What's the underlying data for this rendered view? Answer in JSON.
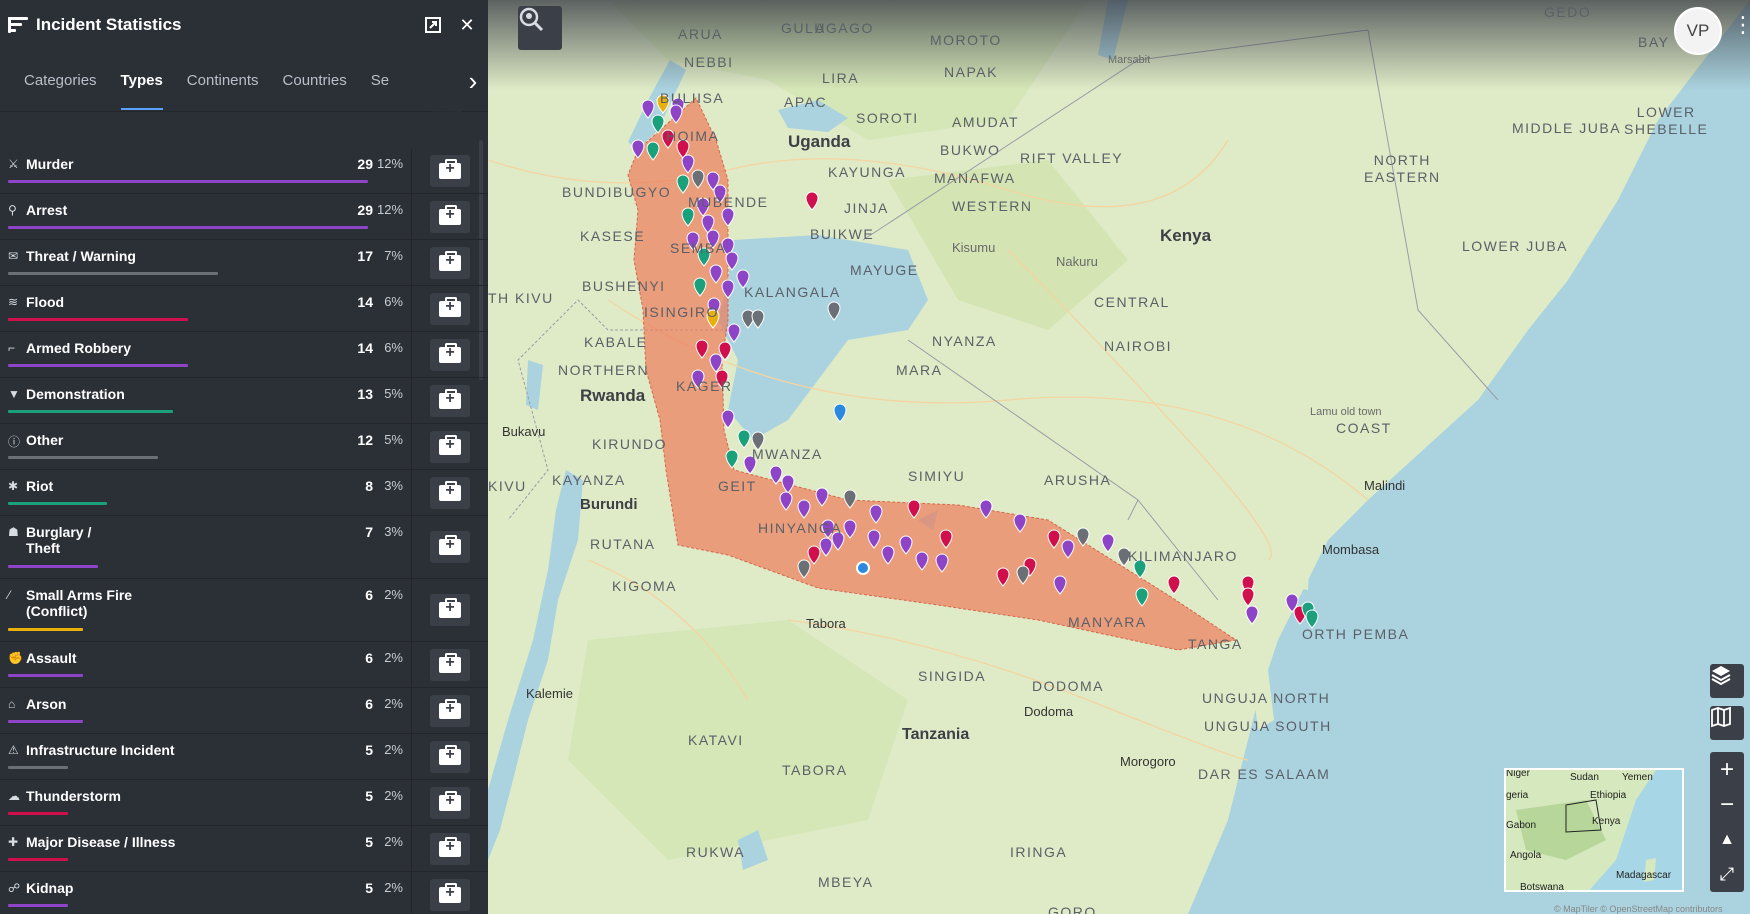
{
  "panel": {
    "title": "Incident Statistics",
    "tabs": [
      "Categories",
      "Types",
      "Continents",
      "Countries",
      "Se"
    ],
    "active_tab": "Types",
    "rows": [
      {
        "icon": "murder-icon",
        "glyph": "⚔",
        "name": "Murder",
        "count": "29",
        "pct": "12%",
        "share": 0.12,
        "color": "#8e44c7"
      },
      {
        "icon": "arrest-icon",
        "glyph": "⚲",
        "name": "Arrest",
        "count": "29",
        "pct": "12%",
        "share": 0.12,
        "color": "#8e44c7"
      },
      {
        "icon": "threat-icon",
        "glyph": "✉",
        "name": "Threat / Warning",
        "count": "17",
        "pct": "7%",
        "share": 0.07,
        "color": "#6b6f76"
      },
      {
        "icon": "flood-icon",
        "glyph": "≋",
        "name": "Flood",
        "count": "14",
        "pct": "6%",
        "share": 0.06,
        "color": "#d0104c"
      },
      {
        "icon": "armed-robbery-icon",
        "glyph": "⌐",
        "name": "Armed Robbery",
        "count": "14",
        "pct": "6%",
        "share": 0.06,
        "color": "#8e44c7"
      },
      {
        "icon": "demonstration-icon",
        "glyph": "▼",
        "name": "Demonstration",
        "count": "13",
        "pct": "5%",
        "share": 0.055,
        "color": "#1aa07a"
      },
      {
        "icon": "other-icon",
        "glyph": "ⓘ",
        "name": "Other",
        "count": "12",
        "pct": "5%",
        "share": 0.05,
        "color": "#6b6f76"
      },
      {
        "icon": "riot-icon",
        "glyph": "✱",
        "name": "Riot",
        "count": "8",
        "pct": "3%",
        "share": 0.033,
        "color": "#1aa07a"
      },
      {
        "icon": "burglary-icon",
        "glyph": "☗",
        "name": "Burglary /\nTheft",
        "count": "7",
        "pct": "3%",
        "share": 0.03,
        "color": "#8e44c7"
      },
      {
        "icon": "small-arms-icon",
        "glyph": "⁄",
        "name": "Small Arms Fire\n(Conflict)",
        "count": "6",
        "pct": "2%",
        "share": 0.025,
        "color": "#e8b00c"
      },
      {
        "icon": "assault-icon",
        "glyph": "✊",
        "name": "Assault",
        "count": "6",
        "pct": "2%",
        "share": 0.025,
        "color": "#8e44c7"
      },
      {
        "icon": "arson-icon",
        "glyph": "⌂",
        "name": "Arson",
        "count": "6",
        "pct": "2%",
        "share": 0.025,
        "color": "#8e44c7"
      },
      {
        "icon": "infrastructure-icon",
        "glyph": "⚠",
        "name": "Infrastructure Incident",
        "count": "5",
        "pct": "2%",
        "share": 0.02,
        "color": "#6b6f76"
      },
      {
        "icon": "thunderstorm-icon",
        "glyph": "☁",
        "name": "Thunderstorm",
        "count": "5",
        "pct": "2%",
        "share": 0.02,
        "color": "#d0104c"
      },
      {
        "icon": "disease-icon",
        "glyph": "✚",
        "name": "Major Disease / Illness",
        "count": "5",
        "pct": "2%",
        "share": 0.02,
        "color": "#d0104c"
      },
      {
        "icon": "kidnap-icon",
        "glyph": "☍",
        "name": "Kidnap",
        "count": "5",
        "pct": "2%",
        "share": 0.02,
        "color": "#8e44c7"
      }
    ]
  },
  "map": {
    "avatar": "VP",
    "labels": {
      "gedo": "GEDO",
      "bay": "BAY",
      "moroto": "MOROTO",
      "agago": "AGAGO",
      "gulu": "GULU",
      "arua": "ARUA",
      "nebbi": "NEBBI",
      "marsabit": "Marsabit",
      "lira": "LIRA",
      "napak": "NAPAK",
      "apac": "APAC",
      "buliisa": "BULIISA",
      "soroti": "SOROTI",
      "amudat": "AMUDAT",
      "hoima": "HOIMA",
      "uganda": "Uganda",
      "bukwo": "BUKWO",
      "middle_juba": "MIDDLE JUBA",
      "lower_shebelle": "LOWER\nSHEBELLE",
      "rift_valley": "RIFT VALLEY",
      "kayunga": "KAYUNGA",
      "manafwa": "MANAFWA",
      "north_eastern": "NORTH\nEASTERN",
      "bundibugyo": "BUNDIBUGYO",
      "mubende": "MUBENDE",
      "jinja": "JINJA",
      "western": "WESTERN",
      "kenya": "Kenya",
      "kasese": "KASESE",
      "buikwe": "BUIKWE",
      "lower_juba": "LOWER JUBA",
      "sembabule": "SEMBA",
      "kisumu": "Kisumu",
      "nakuru": "Nakuru",
      "mayuge": "MAYUGE",
      "bushenyi": "BUSHENYI",
      "kalangala": "KALANGALA",
      "north_kivu": "TH KIVU",
      "isingiro": "ISINGIRO",
      "central": "CENTRAL",
      "kabale": "KABALE",
      "nyanza": "NYANZA",
      "nairobi": "NAIROBI",
      "northern": "NORTHERN",
      "mara": "MARA",
      "rwanda": "Rwanda",
      "kagera": "KAGER",
      "lamu": "Lamu old town",
      "bukavu": "Bukavu",
      "coast": "COAST",
      "kirundo": "KIRUNDO",
      "mwanza": "MWANZA",
      "malindi": "Malindi",
      "kayanza": "KAYANZA",
      "simiyu": "SIMIYU",
      "arusha": "ARUSHA",
      "sivu": "KIVU",
      "geita": "GEIT",
      "burundi": "Burundi",
      "shinyanga": "HINYANGA",
      "kilimanjaro": "KILIMANJARO",
      "mombasa": "Mombasa",
      "rutana": "RUTANA",
      "kigoma": "KIGOMA",
      "manyara": "MANYARA",
      "north_pemba": "ORTH PEMBA",
      "tanga": "TANGA",
      "tabora_city": "Tabora",
      "singida": "SINGIDA",
      "dodoma_region": "DODOMA",
      "kalemie": "Kalemie",
      "unguja_north": "UNGUJA NORTH",
      "dodoma": "Dodoma",
      "unguja_south": "UNGUJA SOUTH",
      "tanzania": "Tanzania",
      "katavi": "KATAVI",
      "tabora": "TABORA",
      "morogoro": "Morogoro",
      "dar": "DAR ES SALAAM",
      "rukwa": "RUKWA",
      "iringa": "IRINGA",
      "mbeya": "MBEYA",
      "goro": "GORO"
    },
    "minimap": {
      "sudan": "Sudan",
      "yemen": "Yemen",
      "niger": "Niger",
      "ethiopia": "Ethiopia",
      "nigeria": "geria",
      "gabon": "Gabon",
      "kenya": "Kenya",
      "angola": "Angola",
      "madagascar": "Madagascar",
      "botswana": "Botswana"
    },
    "attribution": "© MapTiler © OpenStreetMap contributors",
    "marker_colors": {
      "purple": "#8e44c7",
      "red": "#d0104c",
      "teal": "#1aa07a",
      "gray": "#6b6f76",
      "yellow": "#e8b00c",
      "blue": "#2b8ae0"
    },
    "route_color": "#ec7c5b"
  }
}
